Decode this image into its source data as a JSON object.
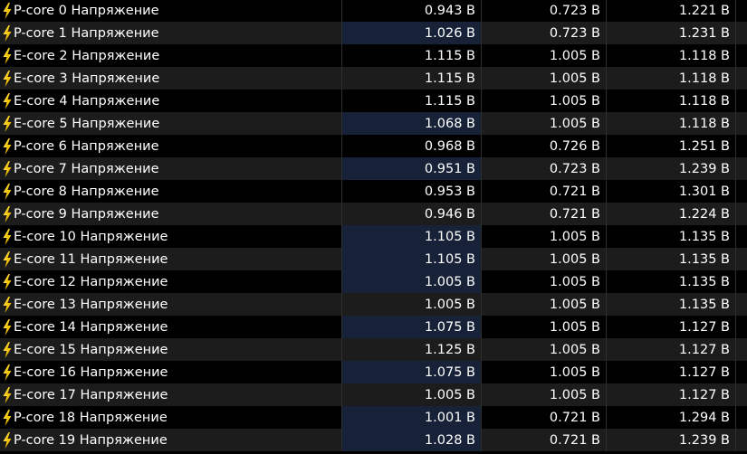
{
  "accent": {
    "row_dark": "#000000",
    "row_light": "#1c1c1c",
    "highlight": "#172238",
    "bolt": "#f5c400"
  },
  "icon": "lightning-bolt-icon",
  "rows": [
    {
      "label": "P-core 0 Напряжение",
      "current": "0.943 В",
      "min": "0.723 В",
      "max": "1.221 В",
      "hl": false
    },
    {
      "label": "P-core 1 Напряжение",
      "current": "1.026 В",
      "min": "0.723 В",
      "max": "1.231 В",
      "hl": true
    },
    {
      "label": "E-core 2 Напряжение",
      "current": "1.115 В",
      "min": "1.005 В",
      "max": "1.118 В",
      "hl": false
    },
    {
      "label": "E-core 3 Напряжение",
      "current": "1.115 В",
      "min": "1.005 В",
      "max": "1.118 В",
      "hl": false
    },
    {
      "label": "E-core 4 Напряжение",
      "current": "1.115 В",
      "min": "1.005 В",
      "max": "1.118 В",
      "hl": false
    },
    {
      "label": "E-core 5 Напряжение",
      "current": "1.068 В",
      "min": "1.005 В",
      "max": "1.118 В",
      "hl": true
    },
    {
      "label": "P-core 6 Напряжение",
      "current": "0.968 В",
      "min": "0.726 В",
      "max": "1.251 В",
      "hl": false
    },
    {
      "label": "P-core 7 Напряжение",
      "current": "0.951 В",
      "min": "0.723 В",
      "max": "1.239 В",
      "hl": true
    },
    {
      "label": "P-core 8 Напряжение",
      "current": "0.953 В",
      "min": "0.721 В",
      "max": "1.301 В",
      "hl": false
    },
    {
      "label": "P-core 9 Напряжение",
      "current": "0.946 В",
      "min": "0.721 В",
      "max": "1.224 В",
      "hl": false
    },
    {
      "label": "E-core 10 Напряжение",
      "current": "1.105 В",
      "min": "1.005 В",
      "max": "1.135 В",
      "hl": true
    },
    {
      "label": "E-core 11 Напряжение",
      "current": "1.105 В",
      "min": "1.005 В",
      "max": "1.135 В",
      "hl": true
    },
    {
      "label": "E-core 12 Напряжение",
      "current": "1.005 В",
      "min": "1.005 В",
      "max": "1.135 В",
      "hl": true
    },
    {
      "label": "E-core 13 Напряжение",
      "current": "1.005 В",
      "min": "1.005 В",
      "max": "1.135 В",
      "hl": false
    },
    {
      "label": "E-core 14 Напряжение",
      "current": "1.075 В",
      "min": "1.005 В",
      "max": "1.127 В",
      "hl": true
    },
    {
      "label": "E-core 15 Напряжение",
      "current": "1.125 В",
      "min": "1.005 В",
      "max": "1.127 В",
      "hl": false
    },
    {
      "label": "E-core 16 Напряжение",
      "current": "1.075 В",
      "min": "1.005 В",
      "max": "1.127 В",
      "hl": true
    },
    {
      "label": "E-core 17 Напряжение",
      "current": "1.005 В",
      "min": "1.005 В",
      "max": "1.127 В",
      "hl": false
    },
    {
      "label": "P-core 18 Напряжение",
      "current": "1.001 В",
      "min": "0.721 В",
      "max": "1.294 В",
      "hl": true
    },
    {
      "label": "P-core 19 Напряжение",
      "current": "1.028 В",
      "min": "0.721 В",
      "max": "1.239 В",
      "hl": true
    }
  ]
}
